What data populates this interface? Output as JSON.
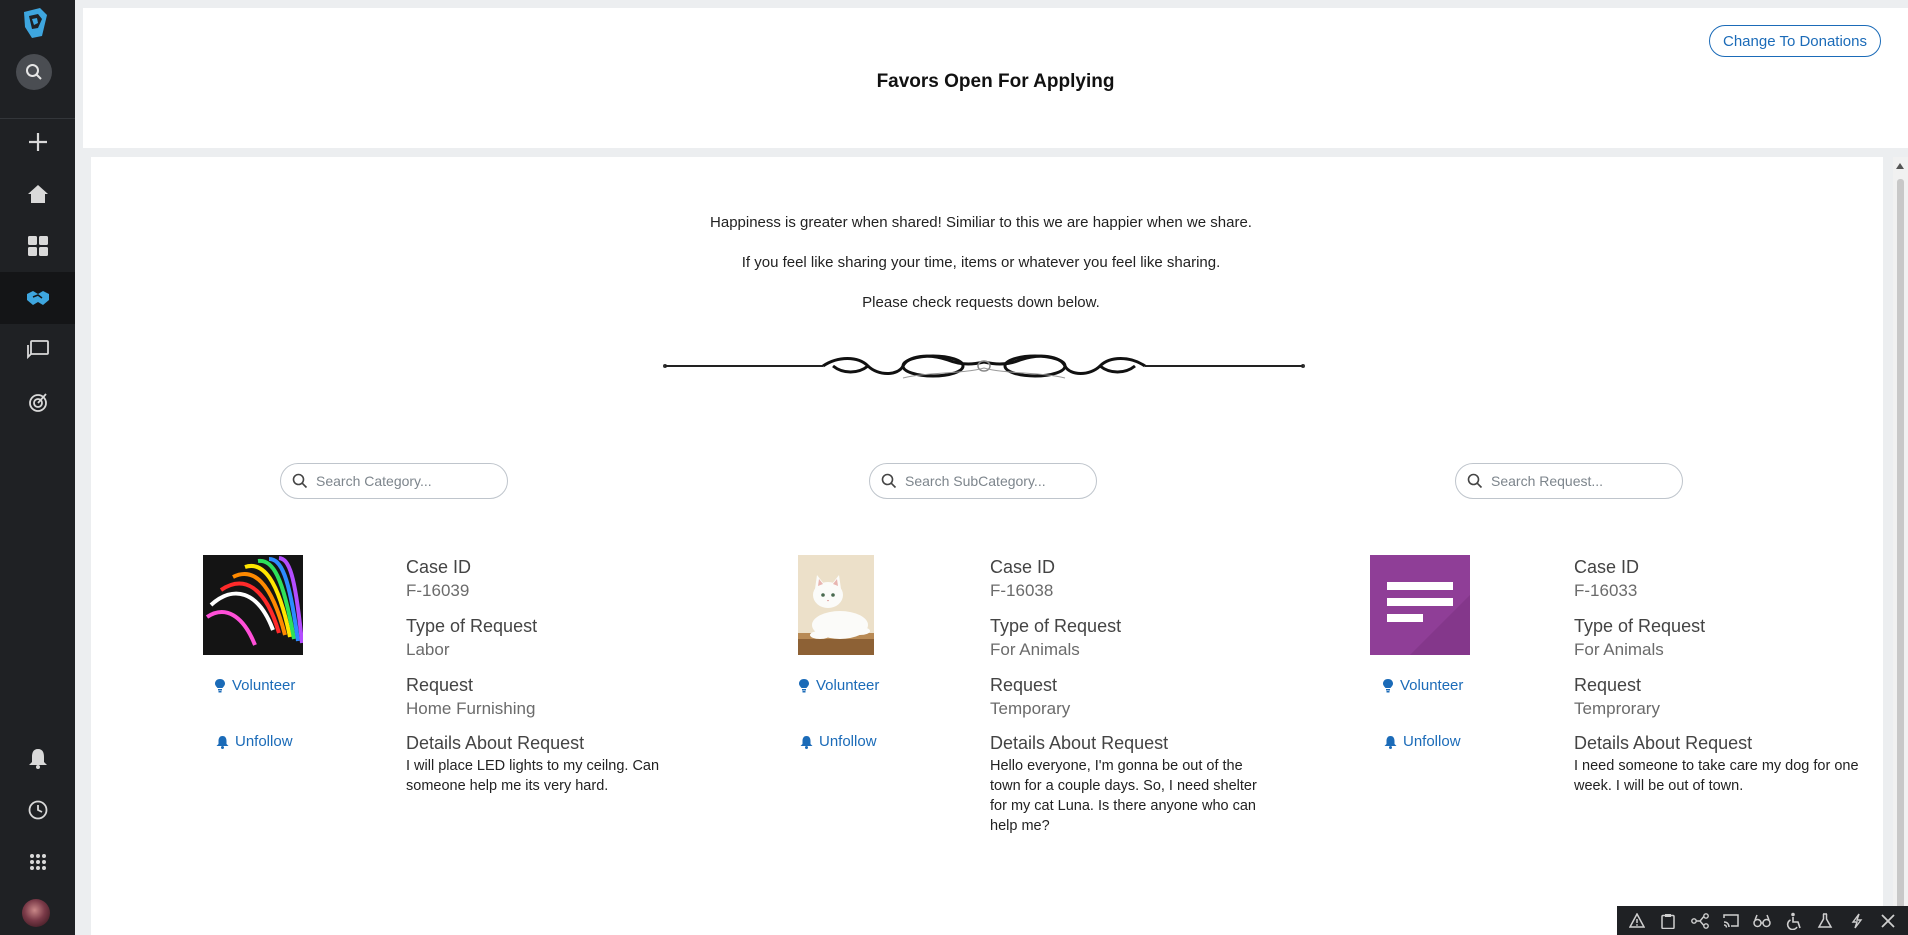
{
  "header": {
    "title": "Favors Open For Applying",
    "toggle_button": "Change To Donations"
  },
  "intro": {
    "line1": "Happiness is greater when shared! Similiar to this we are happier when we share.",
    "line2": "If you feel like sharing your time, items or whatever you feel like sharing.",
    "line3": "Please check requests down below."
  },
  "search": {
    "category_placeholder": "Search Category...",
    "subcategory_placeholder": "Search SubCategory...",
    "request_placeholder": "Search Request..."
  },
  "labels": {
    "case_id": "Case ID",
    "type": "Type of Request",
    "request": "Request",
    "details": "Details About Request",
    "volunteer": "Volunteer",
    "unfollow": "Unfollow"
  },
  "favors": [
    {
      "case_id": "F-16039",
      "type": "Labor",
      "request": "Home Furnishing",
      "details": "I will place LED lights to my ceilng. Can someone help me its very hard.",
      "image": "led-lights"
    },
    {
      "case_id": "F-16038",
      "type": "For Animals",
      "request": "Temporary",
      "details": "Hello everyone, I'm gonna be out of the town for a couple days. So, I need shelter for my cat Luna. Is there anyone who can help me?",
      "image": "white-cat"
    },
    {
      "case_id": "F-16033",
      "type": "For Animals",
      "request": "Temprorary",
      "details": "I need someone to take care my dog for one week. I will be out of town.",
      "image": "document-placeholder"
    }
  ],
  "colors": {
    "sidebar_bg": "#1f2124",
    "accent": "#1b6bb8",
    "active_icon": "#3ea6df",
    "placeholder_purple": "#8f3e97"
  },
  "sidebar": {
    "items": [
      "logo-icon",
      "search-icon",
      "plus-icon",
      "home-icon",
      "grid-icon",
      "handshake-icon",
      "chat-icon",
      "target-icon",
      "bell-icon",
      "history-icon",
      "apps-icon",
      "avatar"
    ]
  },
  "toolbar": {
    "items": [
      "warning-icon",
      "clipboard-icon",
      "sitemap-icon",
      "cast-icon",
      "glasses-icon",
      "accessibility-icon",
      "flask-icon",
      "bolt-icon",
      "close-icon"
    ]
  }
}
